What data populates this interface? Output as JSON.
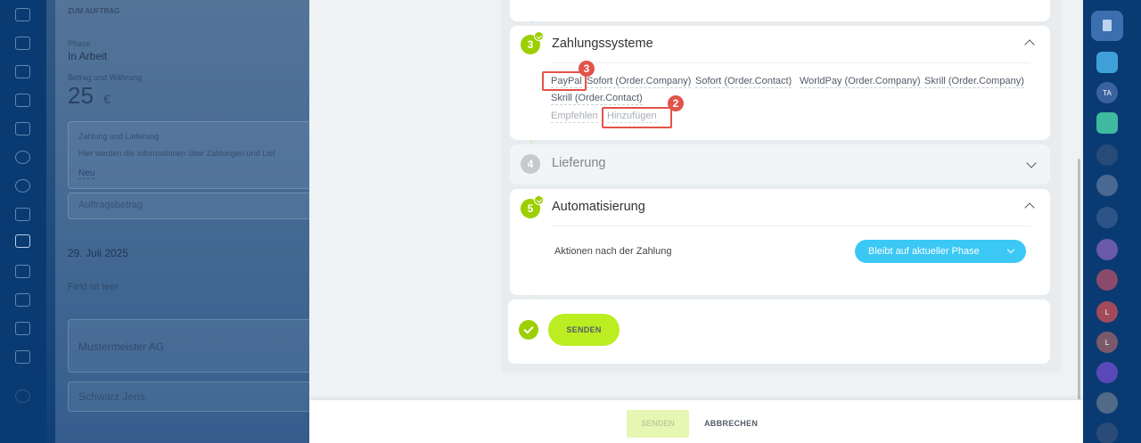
{
  "background": {
    "section_title": "ZUM AUFTRAG",
    "phase_label": "Phase",
    "phase_value": "In Arbeit",
    "amount_label": "Betrag und Währung",
    "amount_value": "25",
    "currency": "€",
    "payment_delivery_label": "Zahlung und Lieferung",
    "payment_delivery_text": "Hier werden die Informationen über Zahlungen und Lief",
    "new_link": "Neu",
    "order_amount_label": "Auftragsbetrag",
    "date_value": "29. Juli 2025",
    "empty_text": "Feld ist leer",
    "company_name": "Mustermeister AG",
    "contact_name": "Schwarz Jens"
  },
  "steps": {
    "payment": {
      "number": "3",
      "title": "Zahlungssysteme",
      "items": [
        "PayPal",
        "Sofort (Order.Company)",
        "Sofort (Order.Contact)",
        "WorldPay (Order.Company)",
        "Skrill (Order.Company)",
        "Skrill (Order.Contact)"
      ],
      "recommend_link": "Empfehlen",
      "add_link": "Hinzufügen"
    },
    "delivery": {
      "number": "4",
      "title": "Lieferung"
    },
    "automation": {
      "number": "5",
      "title": "Automatisierung",
      "action_label": "Aktionen nach der Zahlung",
      "action_value": "Bleibt auf aktueller Phase"
    },
    "send": {
      "button_label": "SENDEN"
    }
  },
  "annotations": {
    "badge_add": "2",
    "badge_paypal": "3"
  },
  "footer": {
    "send_label": "SENDEN",
    "cancel_label": "ABBRECHEN"
  },
  "right_rail": {
    "avatar_ta": "TA",
    "avatar_l1": "L",
    "avatar_l2": "L"
  },
  "colors": {
    "accent_green": "#9dcf00",
    "send_button": "#bbed21",
    "select_blue": "#3bc8f5",
    "annotation_red": "#e2534a"
  }
}
